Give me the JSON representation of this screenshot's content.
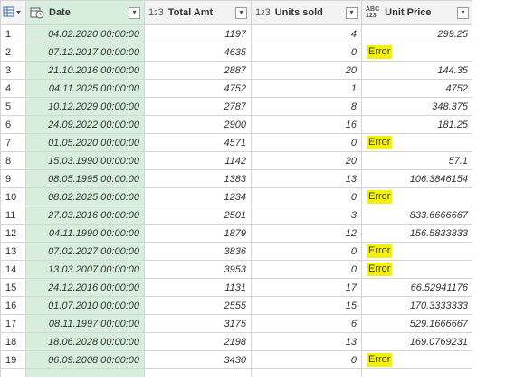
{
  "columns": {
    "date": "Date",
    "total_amt": "Total Amt",
    "units_sold": "Units sold",
    "unit_price": "Unit Price"
  },
  "type_icons": {
    "date": "calendar-clock-icon",
    "total_amt": "1²3",
    "units_sold": "1²3",
    "unit_price": "ABC 123"
  },
  "rows": [
    {
      "idx": "1",
      "date": "04.02.2020 00:00:00",
      "total": "1197",
      "units": "4",
      "price": "299.25"
    },
    {
      "idx": "2",
      "date": "07.12.2017 00:00:00",
      "total": "4635",
      "units": "0",
      "price": "Error"
    },
    {
      "idx": "3",
      "date": "21.10.2016 00:00:00",
      "total": "2887",
      "units": "20",
      "price": "144.35"
    },
    {
      "idx": "4",
      "date": "04.11.2025 00:00:00",
      "total": "4752",
      "units": "1",
      "price": "4752"
    },
    {
      "idx": "5",
      "date": "10.12.2029 00:00:00",
      "total": "2787",
      "units": "8",
      "price": "348.375"
    },
    {
      "idx": "6",
      "date": "24.09.2022 00:00:00",
      "total": "2900",
      "units": "16",
      "price": "181.25"
    },
    {
      "idx": "7",
      "date": "01.05.2020 00:00:00",
      "total": "4571",
      "units": "0",
      "price": "Error"
    },
    {
      "idx": "8",
      "date": "15.03.1990 00:00:00",
      "total": "1142",
      "units": "20",
      "price": "57.1"
    },
    {
      "idx": "9",
      "date": "08.05.1995 00:00:00",
      "total": "1383",
      "units": "13",
      "price": "106.3846154"
    },
    {
      "idx": "10",
      "date": "08.02.2025 00:00:00",
      "total": "1234",
      "units": "0",
      "price": "Error"
    },
    {
      "idx": "11",
      "date": "27.03.2016 00:00:00",
      "total": "2501",
      "units": "3",
      "price": "833.6666667"
    },
    {
      "idx": "12",
      "date": "04.11.1990 00:00:00",
      "total": "1879",
      "units": "12",
      "price": "156.5833333"
    },
    {
      "idx": "13",
      "date": "07.02.2027 00:00:00",
      "total": "3836",
      "units": "0",
      "price": "Error"
    },
    {
      "idx": "14",
      "date": "13.03.2007 00:00:00",
      "total": "3953",
      "units": "0",
      "price": "Error"
    },
    {
      "idx": "15",
      "date": "24.12.2016 00:00:00",
      "total": "1131",
      "units": "17",
      "price": "66.52941176"
    },
    {
      "idx": "16",
      "date": "01.07.2010 00:00:00",
      "total": "2555",
      "units": "15",
      "price": "170.3333333"
    },
    {
      "idx": "17",
      "date": "08.11.1997 00:00:00",
      "total": "3175",
      "units": "6",
      "price": "529.1666667"
    },
    {
      "idx": "18",
      "date": "18.06.2028 00:00:00",
      "total": "2198",
      "units": "13",
      "price": "169.0769231"
    },
    {
      "idx": "19",
      "date": "06.09.2008 00:00:00",
      "total": "3430",
      "units": "0",
      "price": "Error"
    }
  ],
  "colors": {
    "date_column_bg": "#d7eedd",
    "error_highlight": "#f3f010"
  }
}
